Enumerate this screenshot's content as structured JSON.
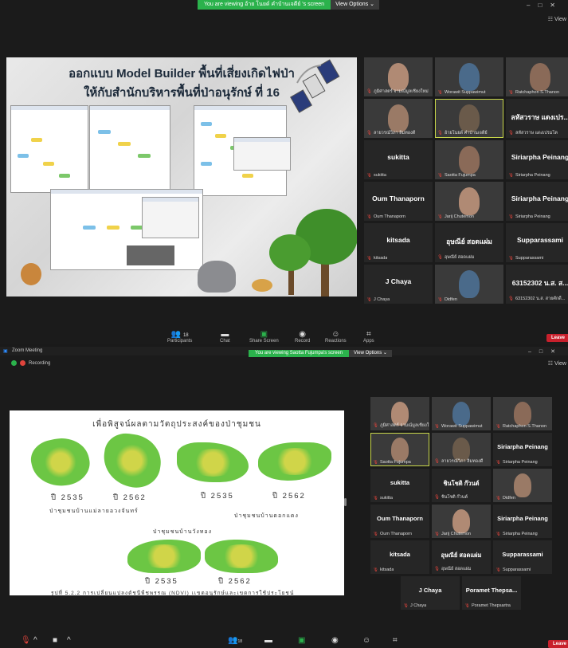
{
  "screens": [
    {
      "banner": {
        "text": "You are viewing อ้าย โนยด์ คำบ้านเจดีย์ 's screen",
        "options": "View Options ⌄"
      },
      "view_label": "☷ View",
      "slide": {
        "title_line1": "ออกแบบ Model Builder พื้นที่เสี่ยงเกิดไฟป่า",
        "title_line2": "ให้กับสำนักบริหารพื้นที่ป่าอนุรักษ์ ที่ 16"
      },
      "tiles": [
        {
          "label": "ภูมิศาสตร์ จามณ์มูลเชียงใหม่",
          "video": true
        },
        {
          "label": "Worawit Suppawimut",
          "video": true
        },
        {
          "label": "Ratchaphon S.Thanon",
          "video": true
        },
        {
          "label": "ลายวรณ์วิภา ลิ่มทองดี",
          "video": true
        },
        {
          "label": "อ้ายโนยด์ คำบ้านเจดีย์",
          "video": true,
          "active": true
        },
        {
          "name": "ลหัสวราษ แดงเปร...",
          "label": "ลหัสวราษ แดงเปรมโต"
        },
        {
          "name": "sukitta",
          "label": "sukitta"
        },
        {
          "label": "Saotta Fujumpa",
          "video": true
        },
        {
          "name": "Siriarpha Peinang",
          "label": "Siriarpha Peinang"
        },
        {
          "name": "Oum Thanaporn",
          "label": "Oum Thanaporn"
        },
        {
          "label": "Jarij Chutemon",
          "video": true
        },
        {
          "name": "Siriarpha Peinang",
          "label": "Siriarpha Peinang"
        },
        {
          "name": "kitsada",
          "label": "kitsada"
        },
        {
          "name": "อุษณีย์ สอดแผ่ม",
          "label": "อุษณีย์ สอดแผ่ม"
        },
        {
          "name": "Supparassami",
          "label": "Supparassami"
        },
        {
          "name": "J Chaya",
          "label": "J Chaya"
        },
        {
          "label": "Didfen",
          "video": true
        },
        {
          "name": "63152302 น.ส. ส...",
          "label": "63152302 น.ส. สายศักดิ์..."
        }
      ],
      "toolbar": {
        "participants": "Participants",
        "participants_count": "18",
        "chat": "Chat",
        "share": "Share Screen",
        "record": "Record",
        "reactions": "Reactions",
        "apps": "Apps",
        "leave": "Leave"
      }
    },
    {
      "window_title": "Zoom Meeting",
      "banner": {
        "text": "You are viewing Saotta Fujumpa's screen",
        "options": "View Options ⌄"
      },
      "recording": "Recording",
      "view_label": "☷ View",
      "slide": {
        "title": "เพื่อพิสูจน์ผลตามวัตถุประสงค์ของป่าชุมชน",
        "years": [
          "ปี 2535",
          "ปี 2562",
          "ปี 2535",
          "ปี 2562",
          "ปี 2535",
          "ปี 2562"
        ],
        "forest_a": "ป่าชุมชนบ้านแม่ลายอวงจันทร์",
        "forest_b": "ป่าชุมชนบ้านดอกแดง",
        "forest_c": "ป่าชุมชนบ้านวังทอง",
        "caption": "รูปที่ 5.2.2 การเปลี่ยนแปลงดัชนีพืชพรรณ (NDVI) เเขตอนุรักษ์และเขตการใช้ประโยชน์"
      },
      "tiles": [
        {
          "label": "ภูมิศาสตร์ จามณ์มูลเชียงใหม่",
          "video": true
        },
        {
          "label": "Worawit Suppawimut",
          "video": true
        },
        {
          "label": "Ratchaphon S.Thanon",
          "video": true
        },
        {
          "label": "Saotta Fujumpa",
          "video": true,
          "active": true
        },
        {
          "label": "ลายวรณ์วิภา ลิ่มทองดี",
          "video": true
        },
        {
          "name": "Siriarpha Peinang",
          "label": "Siriarpha Peinang"
        },
        {
          "name": "sukitta",
          "label": "sukitta"
        },
        {
          "name": "ชินโชติ ก๊วนต์",
          "label": "ชินโชติ ก๊วนต์"
        },
        {
          "label": "Didfen",
          "video": true
        },
        {
          "name": "Oum Thanaporn",
          "label": "Oum Thanaporn"
        },
        {
          "label": "Jarij Chutemon",
          "video": true
        },
        {
          "name": "Siriarpha Peinang",
          "label": "Siriarpha Peinang"
        },
        {
          "name": "kitsada",
          "label": "kitsada"
        },
        {
          "name": "อุษณีย์ สอดแผ่ม",
          "label": "อุษณีย์ สอดแผ่ม"
        },
        {
          "name": "Supparassami",
          "label": "Supparassami"
        },
        {
          "name": "J Chaya",
          "label": "J Chaya"
        },
        {
          "name": "Poramet Thepsa...",
          "label": "Poramet Thepsartra"
        }
      ],
      "toolbar": {
        "participants_count": "18",
        "leave": "Leave"
      }
    }
  ]
}
